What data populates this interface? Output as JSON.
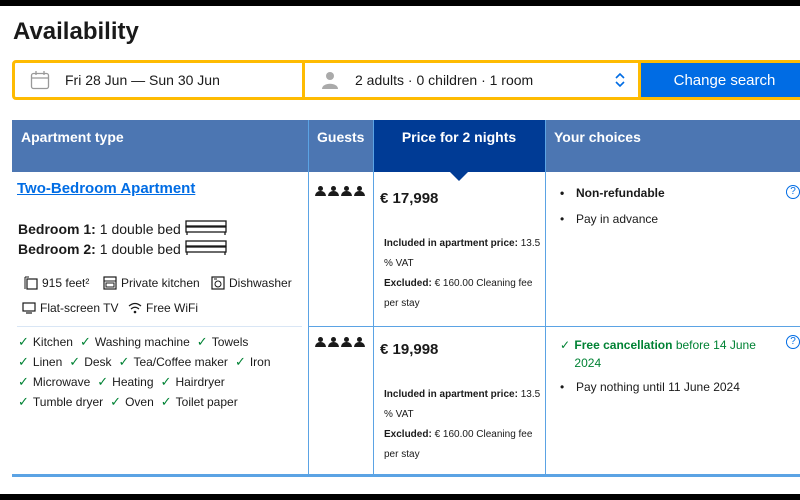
{
  "title": "Availability",
  "search": {
    "dates": "Fri 28 Jun — Sun 30 Jun",
    "guests": "2 adults · 0 children · 1 room",
    "button": "Change search"
  },
  "table": {
    "headers": {
      "type": "Apartment type",
      "guests": "Guests",
      "price": "Price for 2 nights",
      "choices": "Your choices"
    },
    "apartment": {
      "name": "Two-Bedroom Apartment",
      "beds": [
        {
          "label": "Bedroom 1:",
          "value": "1 double bed"
        },
        {
          "label": "Bedroom 2:",
          "value": "1 double bed"
        }
      ],
      "facilities": [
        "915 feet²",
        "Private kitchen",
        "Dishwasher",
        "Flat-screen TV",
        "Free WiFi"
      ],
      "amenities": [
        [
          "Kitchen",
          "Washing machine",
          "Towels"
        ],
        [
          "Linen",
          "Desk",
          "Tea/Coffee maker",
          "Iron"
        ],
        [
          "Microwave",
          "Heating",
          "Hairdryer"
        ],
        [
          "Tumble dryer",
          "Oven",
          "Toilet paper"
        ]
      ]
    },
    "options": [
      {
        "price": "€ 17,998",
        "included_label": "Included in apartment price:",
        "included_value": "13.5 % VAT",
        "excluded_label": "Excluded:",
        "excluded_value": "€ 160.00 Cleaning fee per stay",
        "choices": [
          "Non-refundable",
          "Pay in advance"
        ]
      },
      {
        "price": "€ 19,998",
        "included_label": "Included in apartment price:",
        "included_value": "13.5 % VAT",
        "excluded_label": "Excluded:",
        "excluded_value": "€ 160.00 Cleaning fee per stay",
        "free_cancel_bold": "Free cancellation",
        "free_cancel_rest": "before 14 June 2024",
        "choices": [
          "Pay nothing until 11 June 2024"
        ]
      }
    ]
  },
  "colors": {
    "header": "#4c76b2",
    "header_dark": "#003b95",
    "accent": "#006ce4",
    "border_yellow": "#febb02",
    "green": "#008234"
  }
}
